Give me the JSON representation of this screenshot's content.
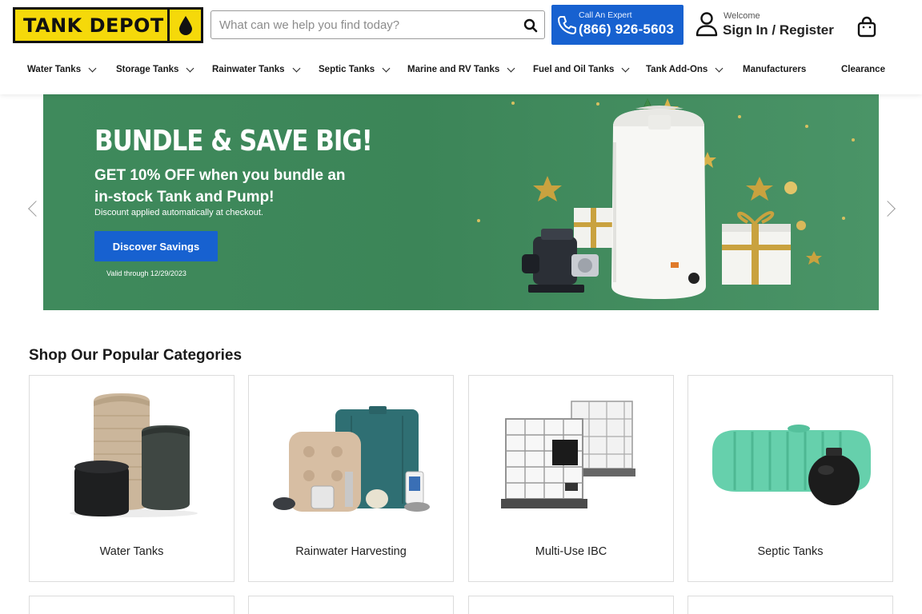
{
  "header": {
    "logo_text": "TANK DEPOT",
    "search_placeholder": "What can we help you find today?",
    "call_label": "Call An Expert",
    "call_phone": "(866) 926-5603",
    "welcome": "Welcome",
    "signin": "Sign In / Register"
  },
  "nav": {
    "items": [
      {
        "label": "Water Tanks",
        "has_dropdown": true
      },
      {
        "label": "Storage Tanks",
        "has_dropdown": true
      },
      {
        "label": "Rainwater Tanks",
        "has_dropdown": true
      },
      {
        "label": "Septic Tanks",
        "has_dropdown": true
      },
      {
        "label": "Marine and RV Tanks",
        "has_dropdown": true
      },
      {
        "label": "Fuel and Oil Tanks",
        "has_dropdown": true
      },
      {
        "label": "Tank Add-Ons",
        "has_dropdown": true
      },
      {
        "label": "Manufacturers",
        "has_dropdown": false
      },
      {
        "label": "Clearance",
        "has_dropdown": false
      }
    ]
  },
  "hero": {
    "title": "BUNDLE & SAVE BIG!",
    "subtitle": "GET 10% OFF when you bundle an in-stock Tank and Pump!",
    "note": "Discount applied automatically at checkout.",
    "button": "Discover Savings",
    "valid": "Valid through 12/29/2023"
  },
  "categories": {
    "heading": "Shop Our Popular Categories",
    "items": [
      {
        "label": "Water Tanks"
      },
      {
        "label": "Rainwater Harvesting"
      },
      {
        "label": "Multi-Use IBC"
      },
      {
        "label": "Septic Tanks"
      }
    ]
  },
  "colors": {
    "brand_yellow": "#f5d90a",
    "brand_blue": "#1761d0",
    "hero_green": "#3f8a5c"
  },
  "icons": [
    "water-drop-icon",
    "search-icon",
    "phone-icon",
    "user-icon",
    "shopping-bag-icon",
    "chevron-down-icon",
    "chevron-left-icon",
    "chevron-right-icon"
  ]
}
